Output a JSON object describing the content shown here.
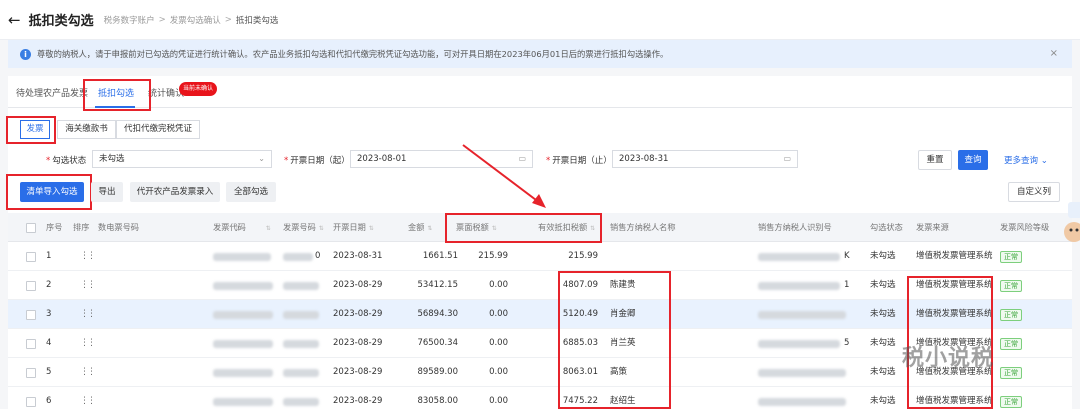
{
  "header": {
    "title": "抵扣类勾选",
    "breadcrumbs": [
      "税务数字账户",
      "发票勾选确认",
      "抵扣类勾选"
    ],
    "separator": ">"
  },
  "notice": {
    "text": "尊敬的纳税人，请于申报前对已勾选的凭证进行统计确认。农产品业务抵扣勾选和代扣代缴完税凭证勾选功能，可对开具日期在2023年06月01日后的票进行抵扣勾选操作。",
    "close": "×"
  },
  "tabs": [
    {
      "label": "待处理农产品发票"
    },
    {
      "label": "抵扣勾选"
    },
    {
      "label": "统计确认"
    }
  ],
  "tab_badge": "当前未确认",
  "subtabs": [
    {
      "label": "发票"
    },
    {
      "label": "海关缴款书"
    },
    {
      "label": "代扣代缴完税凭证"
    }
  ],
  "filters": {
    "status_label": "勾选状态",
    "status_value": "未勾选",
    "start_label": "开票日期（起）",
    "start_value": "2023-08-01",
    "end_label": "开票日期（止）",
    "end_value": "2023-08-31",
    "reset": "重置",
    "query": "查询",
    "more": "更多查询"
  },
  "actions": {
    "import": "清单导入勾选",
    "export": "导出",
    "agri": "代开农产品发票录入",
    "select_all": "全部勾选",
    "custom_cols": "自定义列"
  },
  "table": {
    "headers": [
      "序号",
      "排序",
      "数电票号码",
      "发票代码",
      "发票号码",
      "开票日期",
      "金额",
      "票面税额",
      "有效抵扣税额",
      "销售方纳税人名称",
      "销售方纳税人识别号",
      "勾选状态",
      "发票来源",
      "发票风险等级"
    ],
    "rows": [
      {
        "no": "1",
        "num_suffix": "0",
        "date": "2023-08-31",
        "amount": "1661.51",
        "tax": "215.99",
        "eff": "215.99",
        "seller": "",
        "id_suffix": "K",
        "status": "未勾选",
        "source": "增值税发票管理系统",
        "risk": "正常"
      },
      {
        "no": "2",
        "num_suffix": "",
        "date": "2023-08-29",
        "amount": "53412.15",
        "tax": "0.00",
        "eff": "4807.09",
        "seller": "陈建贵",
        "id_suffix": "1",
        "status": "未勾选",
        "source": "增值税发票管理系统",
        "risk": "正常"
      },
      {
        "no": "3",
        "num_suffix": "",
        "date": "2023-08-29",
        "amount": "56894.30",
        "tax": "0.00",
        "eff": "5120.49",
        "seller": "肖金卿",
        "id_suffix": "",
        "status": "未勾选",
        "source": "增值税发票管理系统",
        "risk": "正常"
      },
      {
        "no": "4",
        "num_suffix": "",
        "date": "2023-08-29",
        "amount": "76500.34",
        "tax": "0.00",
        "eff": "6885.03",
        "seller": "肖兰英",
        "id_suffix": "5",
        "status": "未勾选",
        "source": "增值税发票管理系统",
        "risk": "正常"
      },
      {
        "no": "5",
        "num_suffix": "",
        "date": "2023-08-29",
        "amount": "89589.00",
        "tax": "0.00",
        "eff": "8063.01",
        "seller": "高策",
        "id_suffix": "",
        "status": "未勾选",
        "source": "增值税发票管理系统",
        "risk": "正常"
      },
      {
        "no": "6",
        "num_suffix": "",
        "date": "2023-08-29",
        "amount": "83058.00",
        "tax": "0.00",
        "eff": "7475.22",
        "seller": "赵绍生",
        "id_suffix": "",
        "status": "未勾选",
        "source": "增值税发票管理系统",
        "risk": "正常"
      }
    ]
  },
  "watermark": "税小说税",
  "colors": {
    "accent": "#2a6ee8",
    "annotation": "#e6232b",
    "notice_bg": "#e7f0fd"
  }
}
